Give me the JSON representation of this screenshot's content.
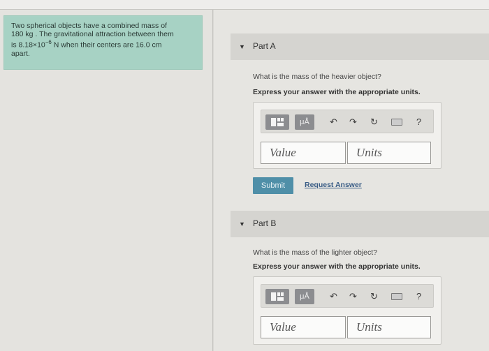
{
  "problem": {
    "text_1": "Two spherical objects have a combined mass of",
    "text_2": "180 kg . The gravitational attraction between them",
    "text_3": "is 8.18×10",
    "exponent": "−6",
    "text_4": " N when their centers are 16.0 cm",
    "text_5": "apart."
  },
  "part_a": {
    "header": "Part A",
    "question": "What is the mass of the heavier object?",
    "instruction": "Express your answer with the appropriate units.",
    "value_placeholder": "Value",
    "units_placeholder": "Units",
    "submit_label": "Submit",
    "request_label": "Request Answer"
  },
  "part_b": {
    "header": "Part B",
    "question": "What is the mass of the lighter object?",
    "instruction": "Express your answer with the appropriate units.",
    "value_placeholder": "Value",
    "units_placeholder": "Units"
  },
  "toolbar": {
    "template_icon": "template-icon",
    "mu_label": "μÅ",
    "help_label": "?"
  }
}
